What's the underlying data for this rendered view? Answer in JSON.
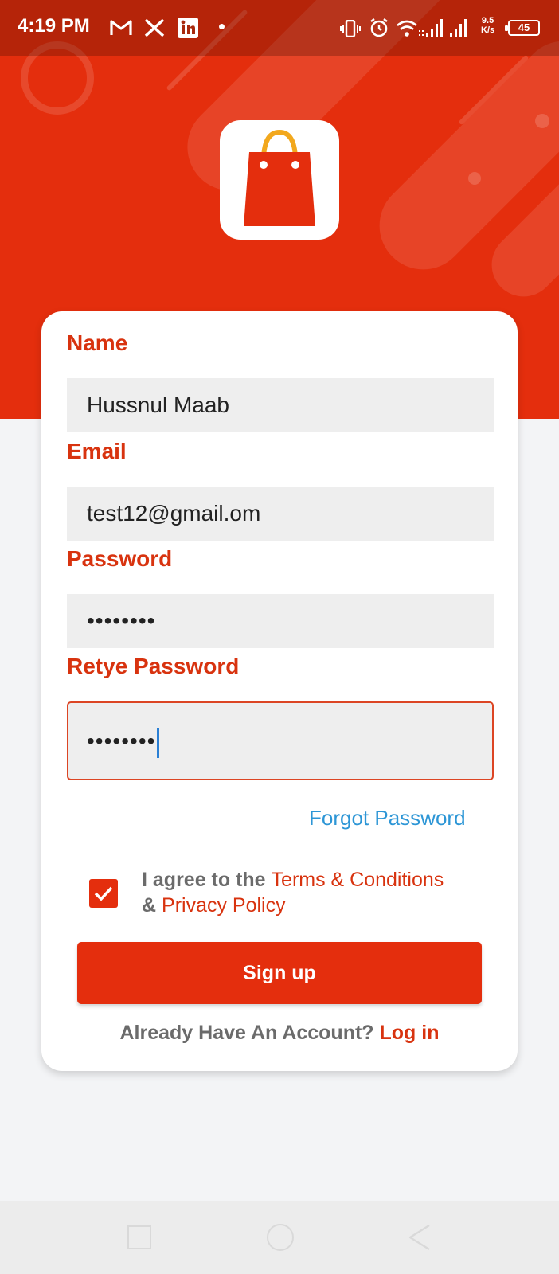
{
  "status_bar": {
    "time": "4:19 PM",
    "notification_icons": [
      "gmail-icon",
      "x-icon",
      "linkedin-icon"
    ],
    "right_icons": [
      "vibrate-icon",
      "alarm-icon",
      "wifi-icon",
      "signal-icon"
    ],
    "network_speed_value": "9.5",
    "network_speed_unit": "K/s",
    "battery": "45"
  },
  "brand": {
    "logo": "shopping-bag-icon",
    "primary_color": "#e42e0d",
    "handle_color": "#f2a81d"
  },
  "form": {
    "name_label": "Name",
    "name_value": "Hussnul Maab",
    "email_label": "Email",
    "email_value": "test12@gmail.om",
    "password_label": "Password",
    "password_value": "••••••••",
    "retype_label": "Retye Password",
    "retype_value": "••••••••",
    "forgot_password": "Forgot Password",
    "agree": {
      "checked": true,
      "prefix": "I agree to the",
      "terms": "Terms & Conditions",
      "amp": "&",
      "privacy": "Privacy Policy"
    },
    "signup_button": "Sign up",
    "login_prompt": "Already Have An Account?",
    "login_link": "Log in"
  },
  "nav_bar": {
    "buttons": [
      "recents-square-icon",
      "home-circle-icon",
      "back-triangle-icon"
    ]
  }
}
